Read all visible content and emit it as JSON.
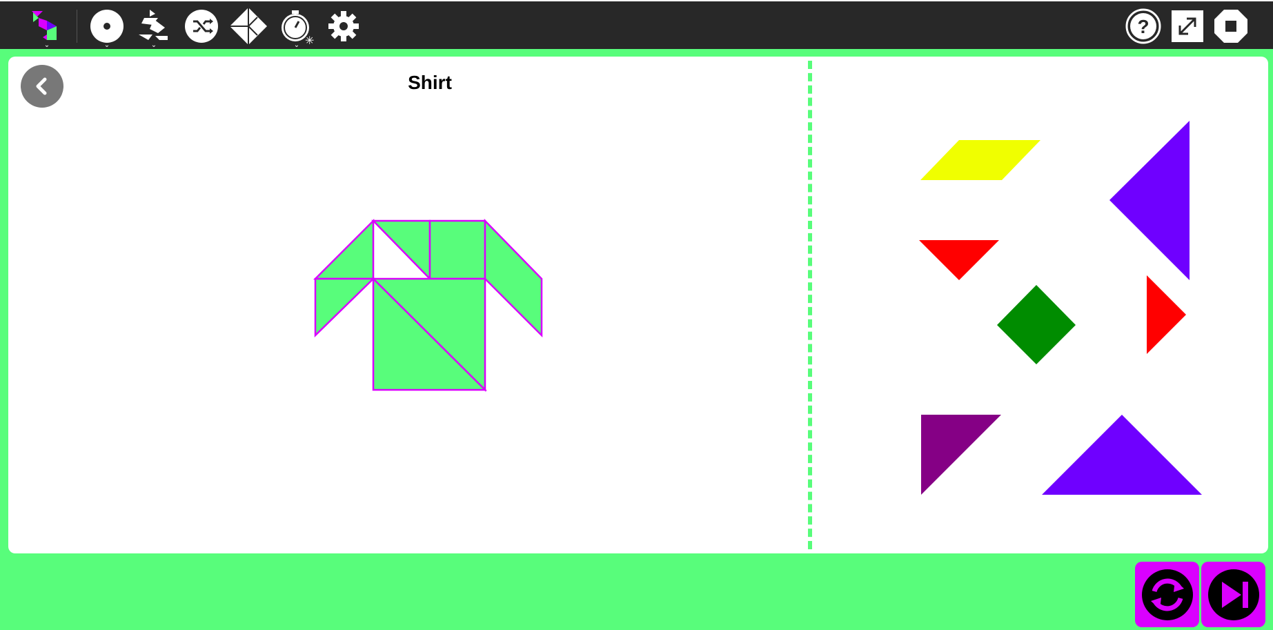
{
  "toolbar": {
    "left_icons": [
      "tangram-logo-icon",
      "target-icon",
      "tangram-figure-icon",
      "shuffle-icon",
      "tangram-square-icon",
      "timer-icon",
      "gear-icon"
    ],
    "right_icons": [
      "help-icon",
      "fullscreen-icon",
      "stop-icon"
    ]
  },
  "puzzle": {
    "title": "Shirt"
  },
  "colors": {
    "background": "#58fd7b",
    "toolbar": "#282828",
    "outline": "#da00ff",
    "target_fill": "#58fd7b",
    "yellow": "#f0ff00",
    "violet": "#6f00ff",
    "red": "#ff0000",
    "green": "#008c00",
    "purple": "#850085"
  },
  "pieces": [
    {
      "name": "parallelogram-yellow",
      "color": "#f0ff00"
    },
    {
      "name": "large-triangle-violet-right",
      "color": "#6f00ff"
    },
    {
      "name": "small-triangle-red-left",
      "color": "#ff0000"
    },
    {
      "name": "square-green",
      "color": "#008c00"
    },
    {
      "name": "small-triangle-red-right",
      "color": "#ff0000"
    },
    {
      "name": "medium-triangle-purple",
      "color": "#850085"
    },
    {
      "name": "large-triangle-violet-bottom",
      "color": "#6f00ff"
    }
  ],
  "bottom_buttons": [
    "restart-icon",
    "skip-next-icon"
  ]
}
